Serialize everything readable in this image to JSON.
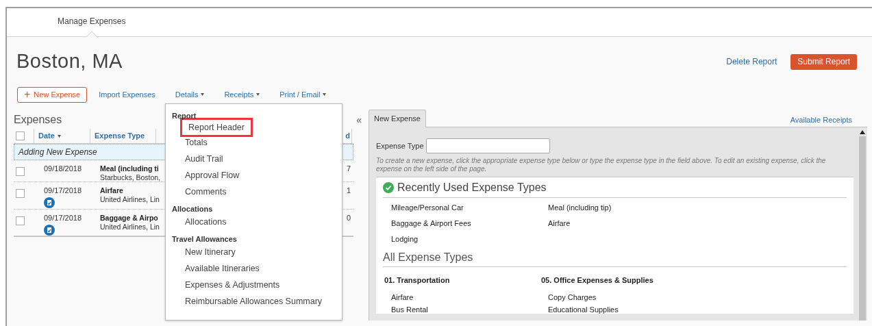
{
  "nav": {
    "tabs": [
      {
        "label": "Manage Expenses",
        "selected": true
      }
    ]
  },
  "report": {
    "title": "Boston, MA",
    "delete_link": "Delete Report",
    "submit_button": "Submit Report"
  },
  "toolbar": {
    "new_button": {
      "icon": "+",
      "label": "New Expense"
    },
    "items": [
      {
        "label": "Import Expenses",
        "dropdown": false,
        "expanded": false
      },
      {
        "label": "Details",
        "dropdown": true,
        "expanded": true
      },
      {
        "label": "Receipts",
        "dropdown": true,
        "expanded": false
      },
      {
        "label": "Print / Email",
        "dropdown": true,
        "expanded": false
      }
    ]
  },
  "details_menu": {
    "sections": [
      {
        "heading": "Report",
        "items": [
          {
            "label": "Report Header",
            "highlighted": true
          },
          {
            "label": "Totals",
            "highlighted": false
          },
          {
            "label": "Audit Trail",
            "highlighted": false
          },
          {
            "label": "Approval Flow",
            "highlighted": false
          },
          {
            "label": "Comments",
            "highlighted": false
          }
        ]
      },
      {
        "heading": "Allocations",
        "items": [
          {
            "label": "Allocations",
            "highlighted": false
          }
        ]
      },
      {
        "heading": "Travel Allowances",
        "items": [
          {
            "label": "New Itinerary",
            "highlighted": false
          },
          {
            "label": "Available Itineraries",
            "highlighted": false
          },
          {
            "label": "Expenses & Adjustments",
            "highlighted": false
          },
          {
            "label": "Reimbursable Allowances Summary",
            "highlighted": false
          }
        ]
      }
    ]
  },
  "expenses": {
    "title": "Expenses",
    "collapse": "«",
    "columns": [
      {
        "label": "Date",
        "sorted": true
      },
      {
        "label": "Expense Type",
        "sorted": false
      },
      {
        "label": "d",
        "sorted": false
      }
    ],
    "header_checked": false,
    "adding_row": "Adding New Expense",
    "rows": [
      {
        "checked": false,
        "date": "09/18/2018",
        "type": "Meal (including ti",
        "vendor": "Starbucks, Boston,",
        "column_4": "7",
        "receipt_icon": false
      },
      {
        "checked": false,
        "date": "09/17/2018",
        "type": "Airfare",
        "vendor": "United Airlines, Lin",
        "column_4": "1",
        "receipt_icon": true
      },
      {
        "checked": false,
        "date": "09/17/2018",
        "type": "Baggage & Airpo",
        "vendor": "United Airlines, Lin",
        "column_4": "0",
        "receipt_icon": true
      }
    ]
  },
  "new_expense_panel": {
    "tabs": [
      {
        "label": "New Expense",
        "selected": true
      }
    ],
    "receipts_link": "Available Receipts",
    "expense_type_label": "Expense Type",
    "hint": "To create a new expense, click the appropriate expense type below or type the expense type in the field above. To edit an existing expense, click the expense on the left side of the page.",
    "recent_title": "Recently Used Expense Types",
    "recent_types": [
      "Mileage/Personal Car",
      "Meal (including tip)",
      "Baggage & Airport Fees",
      "Airfare",
      "Lodging"
    ],
    "all_title": "All Expense Types",
    "groups": [
      {
        "heading": "01. Transportation",
        "items": [
          "Airfare",
          "Bus Rental"
        ]
      },
      {
        "heading": "05. Office Expenses & Supplies",
        "items": [
          "Copy Charges",
          "Educational Supplies"
        ]
      }
    ]
  }
}
